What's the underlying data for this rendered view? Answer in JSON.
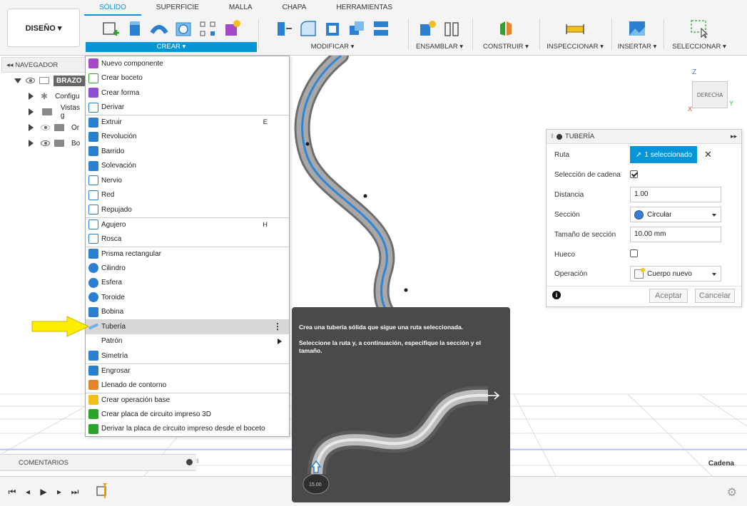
{
  "toolbar": {
    "workspace": "DISEÑO ▾",
    "tabs": [
      "SÓLIDO",
      "SUPERFICIE",
      "MALLA",
      "CHAPA",
      "HERRAMIENTAS"
    ],
    "groups": {
      "crear": "CREAR ▾",
      "modificar": "MODIFICAR ▾",
      "ensamblar": "ENSAMBLAR ▾",
      "construir": "CONSTRUIR ▾",
      "inspeccionar": "INSPECCIONAR ▾",
      "insertar": "INSERTAR ▾",
      "seleccionar": "SELECCIONAR ▾"
    }
  },
  "navigator": {
    "title": "NAVEGADOR",
    "root": "BRAZO",
    "items": [
      "Configu",
      "Vistas g",
      "Or",
      "Bo"
    ]
  },
  "menu": {
    "items": [
      {
        "label": "Nuevo componente",
        "icon": "new-component-icon"
      },
      {
        "label": "Crear boceto",
        "icon": "sketch-icon"
      },
      {
        "label": "Crear forma",
        "icon": "form-icon"
      },
      {
        "label": "Derivar",
        "icon": "derive-icon"
      },
      {
        "label": "Extruir",
        "icon": "extrude-icon",
        "shortcut": "E"
      },
      {
        "label": "Revolución",
        "icon": "revolve-icon"
      },
      {
        "label": "Barrido",
        "icon": "sweep-icon"
      },
      {
        "label": "Solevación",
        "icon": "loft-icon"
      },
      {
        "label": "Nervio",
        "icon": "rib-icon"
      },
      {
        "label": "Red",
        "icon": "web-icon"
      },
      {
        "label": "Repujado",
        "icon": "emboss-icon"
      },
      {
        "label": "Agujero",
        "icon": "hole-icon",
        "shortcut": "H"
      },
      {
        "label": "Rosca",
        "icon": "thread-icon"
      },
      {
        "label": "Prisma rectangular",
        "icon": "box-icon"
      },
      {
        "label": "Cilindro",
        "icon": "cylinder-icon"
      },
      {
        "label": "Esfera",
        "icon": "sphere-icon"
      },
      {
        "label": "Toroide",
        "icon": "torus-icon"
      },
      {
        "label": "Bobina",
        "icon": "coil-icon"
      },
      {
        "label": "Tubería",
        "icon": "pipe-icon"
      },
      {
        "label": "Patrón",
        "icon": ""
      },
      {
        "label": "Simetría",
        "icon": "mirror-icon"
      },
      {
        "label": "Engrosar",
        "icon": "thicken-icon"
      },
      {
        "label": "Llenado de contorno",
        "icon": "boundary-fill-icon"
      },
      {
        "label": "Crear operación base",
        "icon": "base-feature-icon"
      },
      {
        "label": "Crear placa de circuito impreso 3D",
        "icon": "pcb-icon"
      },
      {
        "label": "Derivar la placa de circuito impreso desde el boceto",
        "icon": "pcb-derive-icon"
      }
    ]
  },
  "tooltip": {
    "line1": "Crea una tubería sólida que sigue una ruta seleccionada.",
    "line2": "Seleccione la ruta y, a continuación, especifique la sección y el tamaño.",
    "dim": "15.00"
  },
  "viewcube": {
    "face": "DERECHA",
    "z": "Z",
    "y": "Y",
    "x": "X"
  },
  "panel": {
    "title": "TUBERÍA",
    "rows": {
      "ruta": "Ruta",
      "ruta_value": "1 seleccionado",
      "cadena": "Selección de cadena",
      "cadena_checked": true,
      "distancia": "Distancia",
      "distancia_value": "1.00",
      "seccion": "Sección",
      "seccion_value": "Circular",
      "tamano": "Tamaño de sección",
      "tamano_value": "10.00 mm",
      "hueco": "Hueco",
      "hueco_checked": false,
      "operacion": "Operación",
      "operacion_value": "Cuerpo nuevo"
    },
    "ok": "Aceptar",
    "cancel": "Cancelar"
  },
  "bottom": {
    "comments": "COMENTARIOS",
    "status": "Cadena"
  },
  "colors": {
    "accent": "#0696d7",
    "highlight_arrow": "#ffee00"
  }
}
